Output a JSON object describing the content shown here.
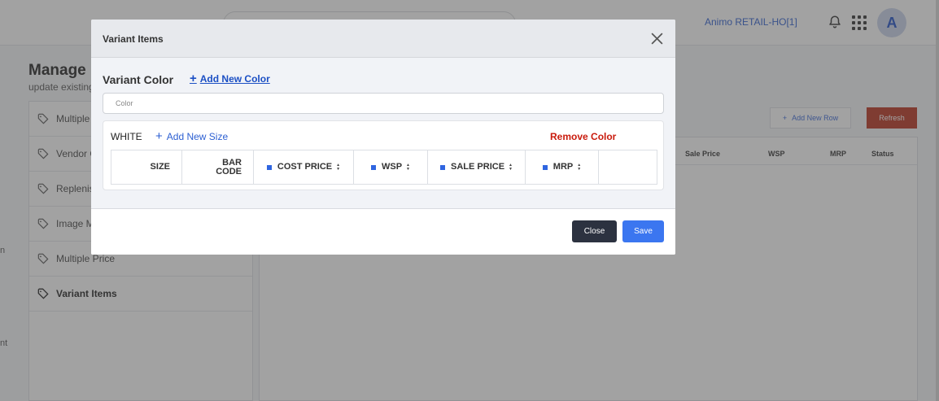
{
  "topbar": {
    "store_name": "Animo RETAIL-HO[1]",
    "avatar_initial": "A"
  },
  "page": {
    "title": "Manage",
    "subtitle": "update existing"
  },
  "side_fragments": [
    "n",
    "nt"
  ],
  "left_menu": {
    "items": [
      {
        "label": "Multiple P"
      },
      {
        "label": "Vendor C"
      },
      {
        "label": "Replenish"
      },
      {
        "label": "Image M"
      },
      {
        "label": "Multiple Price"
      },
      {
        "label": "Variant Items"
      }
    ]
  },
  "background_toolbar": {
    "add_row_label": "Add New Row",
    "refresh_label": "Refresh"
  },
  "background_table": {
    "headers": [
      "Sale Price",
      "WSP",
      "MRP",
      "Status"
    ]
  },
  "modal": {
    "title": "Variant Items",
    "variant_color_label": "Variant Color",
    "add_color_label": "Add New Color",
    "color_placeholder": "Color",
    "color_block": {
      "name": "WHITE",
      "add_size_label": "Add New Size",
      "remove_label": "Remove Color",
      "columns": {
        "size": "SIZE",
        "bar_code_1": "BAR",
        "bar_code_2": "CODE",
        "cost_price": "COST PRICE",
        "wsp": "WSP",
        "sale_price": "SALE PRICE",
        "mrp": "MRP"
      }
    },
    "close_label": "Close",
    "save_label": "Save"
  },
  "colors": {
    "accent": "#3b76f0",
    "danger": "#c91b0d",
    "dark_button": "#2c3240",
    "link": "#1b4fc4"
  }
}
